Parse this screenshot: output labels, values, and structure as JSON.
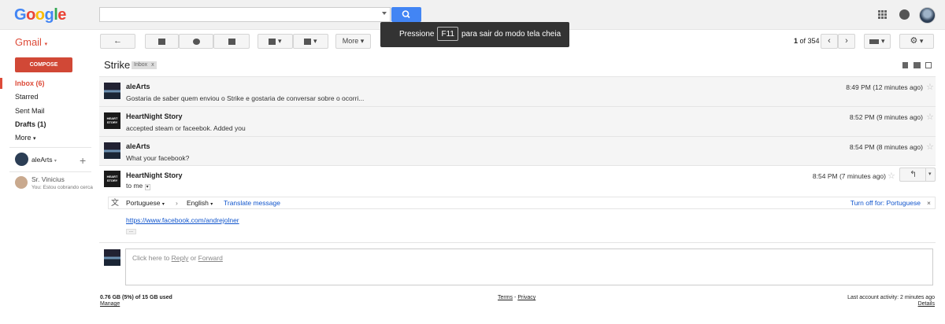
{
  "header": {
    "logo": [
      "G",
      "o",
      "o",
      "g",
      "l",
      "e"
    ],
    "logo_colors": [
      "#4285f4",
      "#ea4335",
      "#fbbc05",
      "#4285f4",
      "#34a853",
      "#ea4335"
    ],
    "search_value": "",
    "search_icon": "search-icon",
    "apps_icon": "apps-grid-icon",
    "notif_icon": "notifications-icon",
    "avatar_icon": "account-avatar"
  },
  "app": {
    "label": "Gmail"
  },
  "toolbar": {
    "more_label": "More",
    "pager_pos": "1",
    "pager_of": "of 354"
  },
  "toast": {
    "prefix": "Pressione",
    "key": "F11",
    "suffix": "para sair do modo tela cheia"
  },
  "sidebar": {
    "compose": "COMPOSE",
    "inbox": "Inbox (6)",
    "starred": "Starred",
    "sent": "Sent Mail",
    "drafts": "Drafts (1)",
    "more": "More",
    "hangouts_user": "aleArts",
    "contact_name": "Sr. Vinicius",
    "contact_status": "You: Estou cobrando cerca"
  },
  "conversation": {
    "subject": "Strike",
    "label": "Inbox",
    "label_close": "x",
    "messages": [
      {
        "from": "aleArts",
        "snippet": "Gostaria de saber quem enviou o Strike e gostaria de conversar sobre o ocorri...",
        "time": "8:49 PM (12 minutes ago)"
      },
      {
        "from": "HeartNight Story",
        "snippet": "accepted steam or faceebok. Added you",
        "time": "8:52 PM (9 minutes ago)"
      },
      {
        "from": "aleArts",
        "snippet": "What your facebook?",
        "time": "8:54 PM (8 minutes ago)"
      }
    ],
    "open": {
      "from": "HeartNight Story",
      "to": "to me",
      "time": "8:54 PM (7 minutes ago)",
      "translate": {
        "from_lang": "Portuguese",
        "to_lang": "English",
        "action": "Translate message",
        "turn_off": "Turn off for: Portuguese"
      },
      "body_link": "https://www.facebook.com/andrejolner",
      "dots": "..."
    },
    "reply": {
      "prefix": "Click here to",
      "reply": "Reply",
      "or": "or",
      "forward": "Forward"
    }
  },
  "footer": {
    "storage": "0.76 GB (5%) of 15 GB used",
    "manage": "Manage",
    "terms": "Terms",
    "sep": "-",
    "privacy": "Privacy",
    "activity": "Last account activity: 2 minutes ago",
    "details": "Details"
  }
}
